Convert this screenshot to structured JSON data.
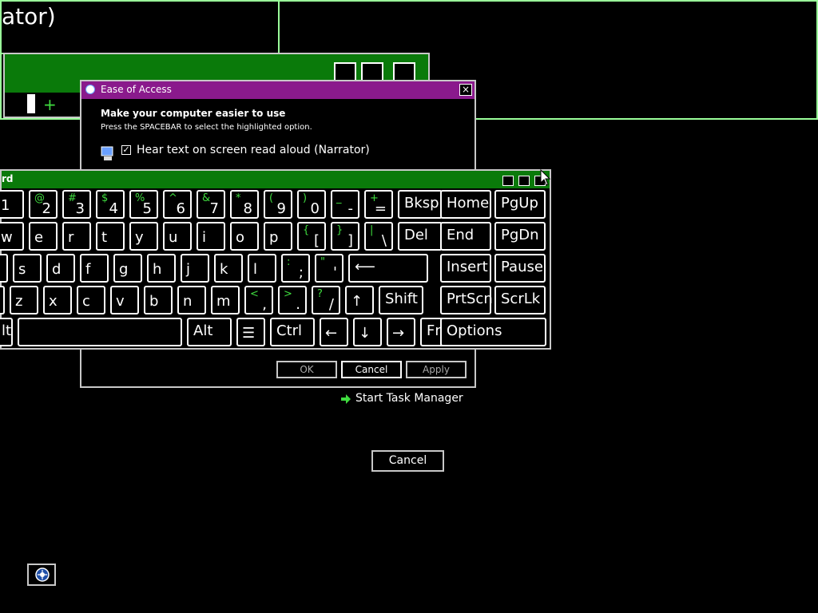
{
  "background_window": {
    "title_fragment": "ator)"
  },
  "ease_of_access": {
    "title": "Ease of Access",
    "close_label": "×",
    "heading": "Make your computer easier to use",
    "instruction": "Press the SPACEBAR to select the highlighted option.",
    "narrator_option": "Hear text on screen read aloud (Narrator)",
    "narrator_checked": true,
    "buttons": {
      "ok": "OK",
      "cancel": "Cancel",
      "apply": "Apply"
    }
  },
  "osk": {
    "title_fragment": "rd",
    "rows": [
      [
        {
          "s": "",
          "m": "1"
        },
        {
          "s": "@",
          "m": "2"
        },
        {
          "s": "#",
          "m": "3"
        },
        {
          "s": "$",
          "m": "4"
        },
        {
          "s": "%",
          "m": "5"
        },
        {
          "s": "^",
          "m": "6"
        },
        {
          "s": "&",
          "m": "7"
        },
        {
          "s": "*",
          "m": "8"
        },
        {
          "s": "(",
          "m": "9"
        },
        {
          "s": ")",
          "m": "0"
        },
        {
          "s": "_",
          "m": "-"
        },
        {
          "s": "+",
          "m": "="
        },
        {
          "s": "",
          "m": "Bksp",
          "w": true
        }
      ],
      [
        {
          "s": "",
          "m": "w"
        },
        {
          "s": "",
          "m": "e"
        },
        {
          "s": "",
          "m": "r"
        },
        {
          "s": "",
          "m": "t"
        },
        {
          "s": "",
          "m": "y"
        },
        {
          "s": "",
          "m": "u"
        },
        {
          "s": "",
          "m": "i"
        },
        {
          "s": "",
          "m": "o"
        },
        {
          "s": "",
          "m": "p"
        },
        {
          "s": "{",
          "m": "["
        },
        {
          "s": "}",
          "m": "]"
        },
        {
          "s": "|",
          "m": "\\"
        },
        {
          "s": "",
          "m": "Del",
          "w": true
        }
      ],
      [
        {
          "s": "",
          "m": ""
        },
        {
          "s": "",
          "m": "s"
        },
        {
          "s": "",
          "m": "d"
        },
        {
          "s": "",
          "m": "f"
        },
        {
          "s": "",
          "m": "g"
        },
        {
          "s": "",
          "m": "h"
        },
        {
          "s": "",
          "m": "j"
        },
        {
          "s": "",
          "m": "k"
        },
        {
          "s": "",
          "m": "l"
        },
        {
          "s": ":",
          "m": ";"
        },
        {
          "s": "\"",
          "m": "'"
        },
        {
          "s": "",
          "m": "⟵",
          "w": true,
          "wide_enter": true
        }
      ],
      [
        {
          "s": "",
          "m": ""
        },
        {
          "s": "",
          "m": "z"
        },
        {
          "s": "",
          "m": "x"
        },
        {
          "s": "",
          "m": "c"
        },
        {
          "s": "",
          "m": "v"
        },
        {
          "s": "",
          "m": "b"
        },
        {
          "s": "",
          "m": "n"
        },
        {
          "s": "",
          "m": "m"
        },
        {
          "s": "<",
          "m": ","
        },
        {
          "s": ">",
          "m": "."
        },
        {
          "s": "?",
          "m": "/"
        },
        {
          "s": "",
          "m": "↑"
        },
        {
          "s": "",
          "m": "Shift",
          "w": true
        }
      ],
      [
        {
          "s": "",
          "m": "lt",
          "w": true
        },
        {
          "s": "",
          "m": "",
          "space": true
        },
        {
          "s": "",
          "m": "Alt",
          "w": true
        },
        {
          "s": "",
          "m": "☰"
        },
        {
          "s": "",
          "m": "Ctrl",
          "w": true
        },
        {
          "s": "",
          "m": "←"
        },
        {
          "s": "",
          "m": "↓"
        },
        {
          "s": "",
          "m": "→"
        },
        {
          "s": "",
          "m": "Fn",
          "w": true
        }
      ]
    ],
    "nav_keys": [
      [
        "Home",
        "PgUp"
      ],
      [
        "End",
        "PgDn"
      ],
      [
        "Insert",
        "Pause"
      ],
      [
        "PrtScn",
        "ScrLk"
      ]
    ],
    "options_label": "Options"
  },
  "task_manager_link": "Start Task Manager",
  "cancel_button": "Cancel",
  "colors": {
    "green_title": "#0a7a0a",
    "purple_title": "#8a1a8c",
    "shift_glyph": "#3fdc3f"
  }
}
